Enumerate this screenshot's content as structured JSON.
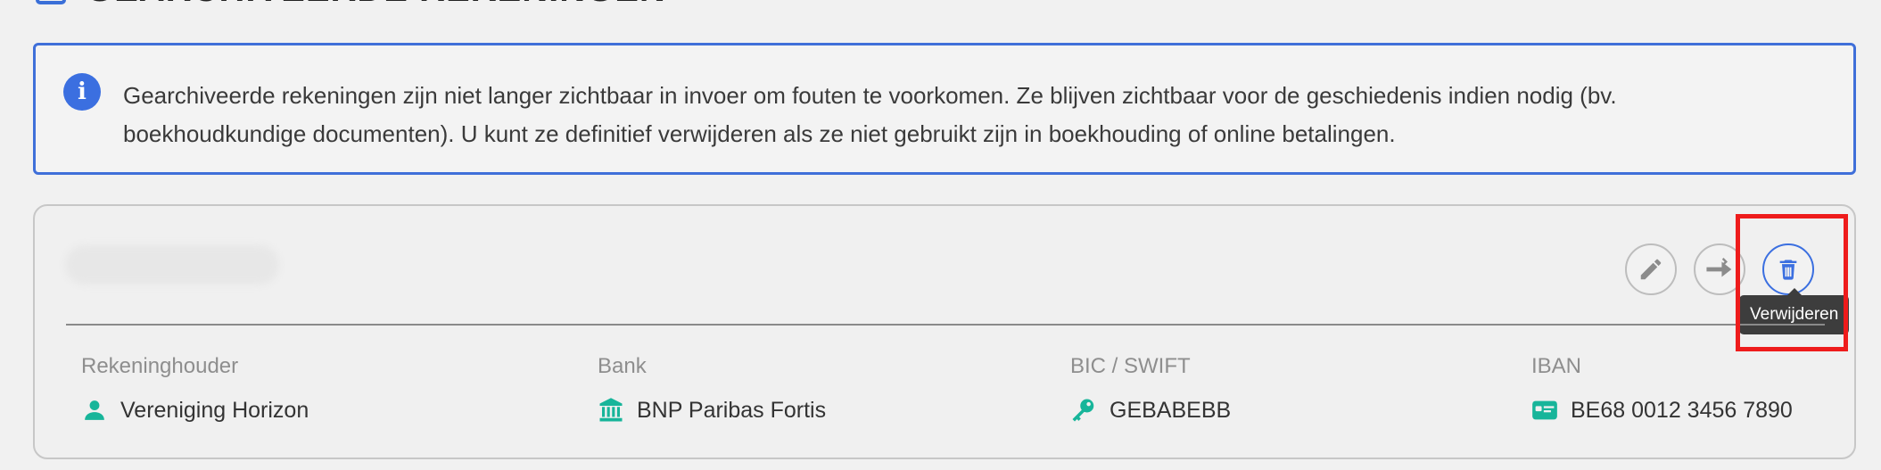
{
  "header": {
    "title": "Gearchiveerde rekeningen"
  },
  "info": {
    "text": "Gearchiveerde rekeningen zijn niet langer zichtbaar in invoer om fouten te voorkomen. Ze blijven zichtbaar voor de geschiedenis indien nodig (bv. boekhoudkundige documenten). U kunt ze definitief verwijderen als ze niet gebruikt zijn in boekhouding of online betalingen.",
    "icon": "info-icon"
  },
  "account": {
    "actions": {
      "edit_icon": "pencil-icon",
      "move_icon": "transfer-arrow-icon",
      "delete_icon": "trash-icon",
      "delete_tooltip": "Verwijderen"
    },
    "fields": [
      {
        "label": "Rekeninghouder",
        "value": "Vereniging Horizon",
        "icon": "person-icon"
      },
      {
        "label": "Bank",
        "value": "BNP Paribas Fortis",
        "icon": "bank-icon"
      },
      {
        "label": "BIC / SWIFT",
        "value": "GEBABEBB",
        "icon": "key-icon"
      },
      {
        "label": "IBAN",
        "value": "BE68 0012 3456 7890",
        "icon": "card-icon"
      }
    ]
  },
  "colors": {
    "accent": "#3b6fe0",
    "teal": "#17b59a",
    "highlight": "#ee1c1c"
  }
}
